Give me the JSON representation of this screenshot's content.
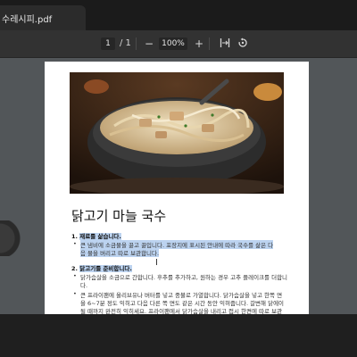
{
  "tab": {
    "title": "수레시피.pdf"
  },
  "toolbar": {
    "page_current": "1",
    "page_total": "/ 1",
    "zoom_out": "−",
    "zoom_value": "100%",
    "zoom_in": "+",
    "fit_icon": "fit-page-icon",
    "rotate_icon": "rotate-icon"
  },
  "document": {
    "title": "닭고기 마늘 국수",
    "section1_num": "1.",
    "section1_title": "재료를 삶습니다.",
    "s1_line1": "큰 냄비에 소금물을 끓고 끓입니다. 포장지에 표시된 안내에 따라 국수를 삶은 다",
    "s1_line2": "음 물을 버리고 따로 보관합니다.",
    "section2_num": "2.",
    "section2_title": "닭고기를 준비합니다.",
    "s2_line1": "닭가슴살을 소금으로 간합니다. 후추를 추가하고, 원하는 경우 고추 플레이크를 더합니",
    "s2_line2": "다.",
    "s2_line3": "큰 프라이팬에 올리브유나 버터를 넣고 중불로 가열합니다. 닭가슴살을 넣고 한쪽 면",
    "s2_line4": "을 6~7분 정도 익히고 다음 다른 쪽 면도 같은 시간 동안 익혀줍니다. 갈변해 닭에이",
    "s2_line5": "될 때까지 완전히 익히세요. 프라이팬에서 닭가슴살을 내리고 접시 한켠에 따로 보관"
  },
  "colors": {
    "highlight": "#bcd3f0",
    "viewer_bg": "#525659"
  }
}
